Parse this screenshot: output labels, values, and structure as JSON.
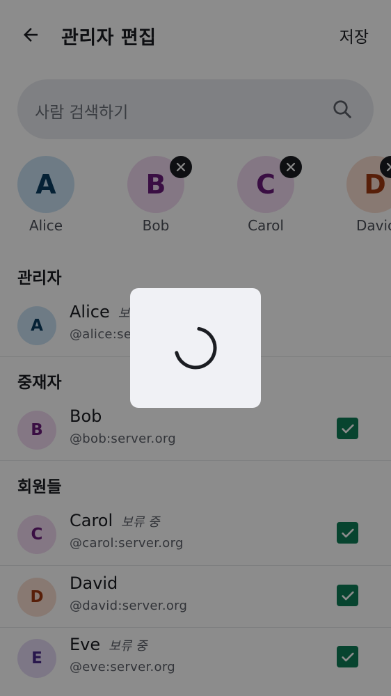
{
  "header": {
    "title": "관리자 편집",
    "save_label": "저장"
  },
  "search": {
    "placeholder": "사람 검색하기"
  },
  "selected": [
    {
      "initial": "A",
      "name": "Alice",
      "bg": "#c8e1f3",
      "fg": "#0a3d62"
    },
    {
      "initial": "B",
      "name": "Bob",
      "bg": "#f0d9f0",
      "fg": "#6a1b7a"
    },
    {
      "initial": "C",
      "name": "Carol",
      "bg": "#f0d9f0",
      "fg": "#6a1b7a"
    },
    {
      "initial": "D",
      "name": "Davic",
      "bg": "#f7dccf",
      "fg": "#a13a12"
    }
  ],
  "sections": {
    "admins": "관리자",
    "moderators": "중재자",
    "members": "회원들"
  },
  "people": [
    {
      "initial": "A",
      "name": "Alice",
      "tag": "보",
      "id": "@alice:se",
      "bg": "#c8e1f3",
      "fg": "#0a3d62",
      "checked": false
    },
    {
      "initial": "B",
      "name": "Bob",
      "tag": "",
      "id": "@bob:server.org",
      "bg": "#f0d9f0",
      "fg": "#6a1b7a",
      "checked": true
    },
    {
      "initial": "C",
      "name": "Carol",
      "tag": "보류 중",
      "id": "@carol:server.org",
      "bg": "#f0d9f0",
      "fg": "#6a1b7a",
      "checked": true
    },
    {
      "initial": "D",
      "name": "David",
      "tag": "",
      "id": "@david:server.org",
      "bg": "#f7dccf",
      "fg": "#a13a12",
      "checked": true
    },
    {
      "initial": "E",
      "name": "Eve",
      "tag": "보류 중",
      "id": "@eve:server.org",
      "bg": "#e3d9f5",
      "fg": "#4a2a8a",
      "checked": true
    }
  ],
  "colors": {
    "accent": "#0e7c56",
    "scrim": "rgba(0,0,0,0.45)",
    "dialog": "#f0f1f5"
  },
  "icons": {
    "back": "arrow-left-icon",
    "search": "magnifier-icon",
    "remove": "close-icon",
    "check": "checkmark-icon",
    "loading": "spinner-icon"
  }
}
